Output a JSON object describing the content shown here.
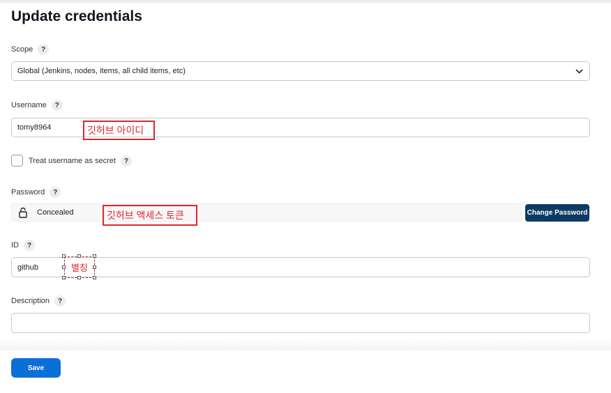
{
  "page": {
    "title": "Update credentials"
  },
  "scope": {
    "label": "Scope",
    "help": "?",
    "value": "Global (Jenkins, nodes, items, all child items, etc)"
  },
  "username": {
    "label": "Username",
    "help": "?",
    "value": "tomy8964",
    "annotation": "깃허브 아이디"
  },
  "treat_secret": {
    "label": "Treat username as secret",
    "help": "?",
    "checked": false
  },
  "password": {
    "label": "Password",
    "help": "?",
    "status": "Concealed",
    "change_button": "Change Password",
    "annotation": "깃허브 액세스 토큰"
  },
  "id_field": {
    "label": "ID",
    "help": "?",
    "value": "github",
    "annotation": "별칭"
  },
  "description": {
    "label": "Description",
    "help": "?",
    "value": ""
  },
  "footer": {
    "save_label": "Save"
  },
  "colors": {
    "annotation_red": "#e0262a",
    "save_blue": "#0b6fd8",
    "change_btn_navy": "#0c3b63"
  },
  "icons": {
    "dropdown": "chevron-down-icon",
    "password": "lock-icon"
  }
}
